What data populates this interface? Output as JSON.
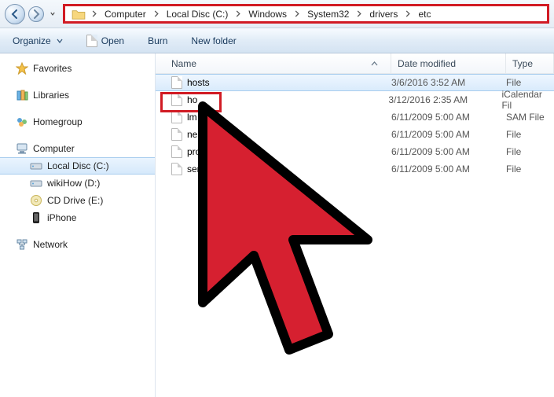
{
  "breadcrumb": [
    "Computer",
    "Local Disc (C:)",
    "Windows",
    "System32",
    "drivers",
    "etc"
  ],
  "toolbar": {
    "organize": "Organize",
    "open": "Open",
    "burn": "Burn",
    "newfolder": "New folder"
  },
  "sidebar": {
    "favorites": "Favorites",
    "libraries": "Libraries",
    "homegroup": "Homegroup",
    "computer": "Computer",
    "drives": [
      {
        "label": "Local Disc (C:)",
        "icon": "hdd"
      },
      {
        "label": "wikiHow (D:)",
        "icon": "hdd"
      },
      {
        "label": "CD Drive (E:)",
        "icon": "cd"
      },
      {
        "label": "iPhone",
        "icon": "device"
      }
    ],
    "network": "Network"
  },
  "columns": {
    "name": "Name",
    "date": "Date modified",
    "type": "Type"
  },
  "files": [
    {
      "name": "hosts",
      "date": "3/6/2016 3:52 AM",
      "type": "File",
      "selected": true
    },
    {
      "name": "ho",
      "date": "3/12/2016 2:35 AM",
      "type": "iCalendar Fil"
    },
    {
      "name": "lm",
      "date": "6/11/2009 5:00 AM",
      "type": "SAM File"
    },
    {
      "name": "ne",
      "date": "6/11/2009 5:00 AM",
      "type": "File"
    },
    {
      "name": "pro",
      "date": "6/11/2009 5:00 AM",
      "type": "File"
    },
    {
      "name": "ser",
      "date": "6/11/2009 5:00 AM",
      "type": "File"
    }
  ]
}
